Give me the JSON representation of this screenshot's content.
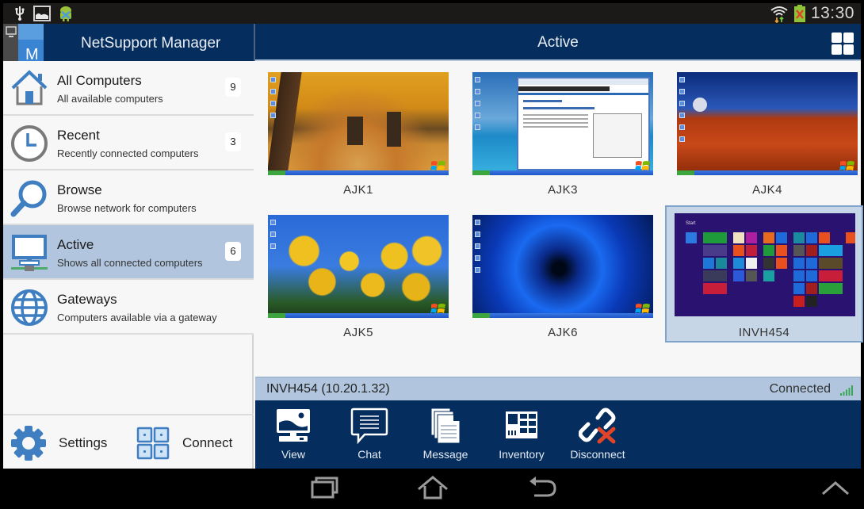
{
  "status_bar": {
    "left_icons": [
      "usb-icon",
      "image-icon",
      "android-debug-icon"
    ],
    "right_icons": [
      "wifi-icon",
      "battery-charging-icon"
    ],
    "time": "13:30"
  },
  "sidebar": {
    "app_title": "NetSupport Manager",
    "logo_letter": "M",
    "items": [
      {
        "id": "all-computers",
        "icon": "house-icon",
        "title": "All Computers",
        "subtitle": "All available computers",
        "count": "9",
        "active": false
      },
      {
        "id": "recent",
        "icon": "clock-icon",
        "title": "Recent",
        "subtitle": "Recently connected computers",
        "count": "3",
        "active": false
      },
      {
        "id": "browse",
        "icon": "magnifier-icon",
        "title": "Browse",
        "subtitle": "Browse network for computers",
        "count": null,
        "active": false
      },
      {
        "id": "active",
        "icon": "networked-computer-icon",
        "title": "Active",
        "subtitle": "Shows all connected computers",
        "count": "6",
        "active": true
      },
      {
        "id": "gateways",
        "icon": "globe-icon",
        "title": "Gateways",
        "subtitle": "Computers available via a gateway",
        "count": null,
        "active": false
      }
    ],
    "footer": {
      "settings_label": "Settings",
      "connect_label": "Connect"
    }
  },
  "main": {
    "title": "Active",
    "view_toggle_icon": "grid-view-icon",
    "computers": [
      {
        "name": "AJK1",
        "wallpaper": "autumn-trees",
        "selected": false
      },
      {
        "name": "AJK3",
        "wallpaper": "browser-window",
        "selected": false
      },
      {
        "name": "AJK4",
        "wallpaper": "red-desert",
        "selected": false
      },
      {
        "name": "AJK5",
        "wallpaper": "yellow-tulips",
        "selected": false
      },
      {
        "name": "AJK6",
        "wallpaper": "blue-starburst",
        "selected": false
      },
      {
        "name": "INVH454",
        "wallpaper": "windows8-start",
        "selected": true
      }
    ],
    "selected_info": {
      "host": "INVH454 (10.20.1.32)",
      "status": "Connected",
      "status_color": "#3aa655"
    },
    "actions": [
      {
        "label": "View",
        "icon": "view-monitor-icon"
      },
      {
        "label": "Chat",
        "icon": "chat-bubble-icon"
      },
      {
        "label": "Message",
        "icon": "message-documents-icon"
      },
      {
        "label": "Inventory",
        "icon": "inventory-icon"
      },
      {
        "label": "Disconnect",
        "icon": "disconnect-link-icon"
      }
    ]
  },
  "colors": {
    "header_bg": "#052d5d",
    "active_row": "#b1c6de",
    "icon_blue": "#3f7fc1",
    "disconnect_red": "#e0452a"
  },
  "system_nav": [
    "recent-apps-icon",
    "home-icon",
    "back-icon",
    "chevron-up-icon"
  ]
}
